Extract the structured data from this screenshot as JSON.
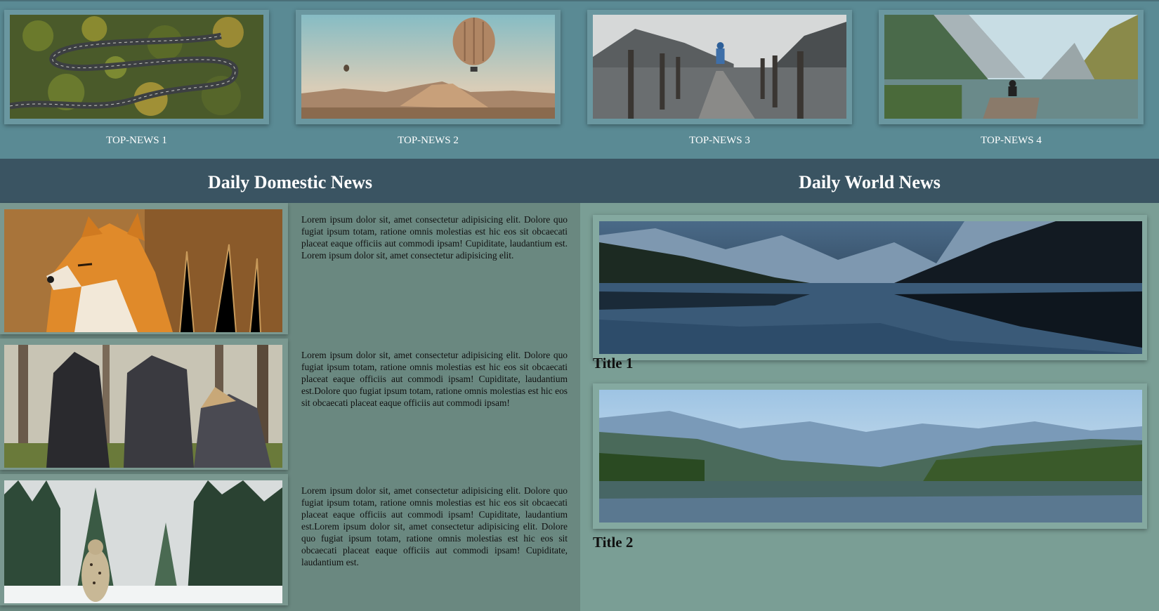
{
  "top_news": [
    {
      "label": "TOP-NEWS 1",
      "image": "aerial-forest-road"
    },
    {
      "label": "TOP-NEWS 2",
      "image": "hot-air-balloon-desert"
    },
    {
      "label": "TOP-NEWS 3",
      "image": "lake-pier-person"
    },
    {
      "label": "TOP-NEWS 4",
      "image": "mountain-lake-person"
    }
  ],
  "domestic": {
    "heading": "Daily Domestic News",
    "items": [
      {
        "image": "red-fox",
        "text": "Lorem ipsum dolor sit, amet consectetur adipisicing elit. Dolore quo fugiat ipsum totam, ratione omnis molestias est hic eos sit obcaecati placeat eaque officiis aut commodi ipsam! Cupiditate, laudantium est. Lorem ipsum dolor sit, amet consectetur adipisicing elit."
      },
      {
        "image": "grey-wolves",
        "text": "Lorem ipsum dolor sit, amet consectetur adipisicing elit. Dolore quo fugiat ipsum totam, ratione omnis molestias est hic eos sit obcaecati placeat eaque officiis aut commodi ipsam! Cupiditate, laudantium est.Dolore quo fugiat ipsum totam, ratione omnis molestias est hic eos sit obcaecati placeat eaque officiis aut commodi ipsam!"
      },
      {
        "image": "snow-leopard-forest",
        "text": "Lorem ipsum dolor sit, amet consectetur adipisicing elit. Dolore quo fugiat ipsum totam, ratione omnis molestias est hic eos sit obcaecati placeat eaque officiis aut commodi ipsam! Cupiditate, laudantium est.Lorem ipsum dolor sit, amet consectetur adipisicing elit. Dolore quo fugiat ipsum totam, ratione omnis molestias est hic eos sit obcaecati placeat eaque officiis aut commodi ipsam! Cupiditate, laudantium est."
      }
    ]
  },
  "world": {
    "heading": "Daily World News",
    "items": [
      {
        "image": "mountain-lake-reflection",
        "title": "Title 1"
      },
      {
        "image": "forest-lake-valley",
        "title": "Title 2"
      }
    ]
  },
  "colors": {
    "top_bar": "#5a8a94",
    "section_header": "#3a5462",
    "domestic_bg": "#6a8880",
    "world_bg": "#7a9e95"
  }
}
